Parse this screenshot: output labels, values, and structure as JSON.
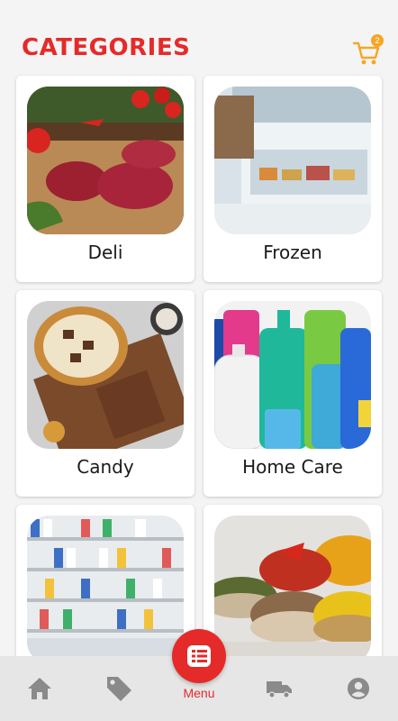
{
  "header": {
    "title": "CATEGORIES",
    "cart_count": "2",
    "cart_icon": "cart-icon"
  },
  "categories": [
    {
      "label": "Deli"
    },
    {
      "label": "Frozen"
    },
    {
      "label": "Candy"
    },
    {
      "label": "Home Care"
    },
    {
      "label": ""
    },
    {
      "label": ""
    }
  ],
  "nav": {
    "home_icon": "home-icon",
    "deals_icon": "tag-icon",
    "menu_label": "Menu",
    "delivery_icon": "truck-icon",
    "account_icon": "account-icon"
  },
  "colors": {
    "accent": "#e52a2a",
    "badge": "#f6a623",
    "nav_bg": "#e6e6e6",
    "icon": "#8a8a8a"
  }
}
